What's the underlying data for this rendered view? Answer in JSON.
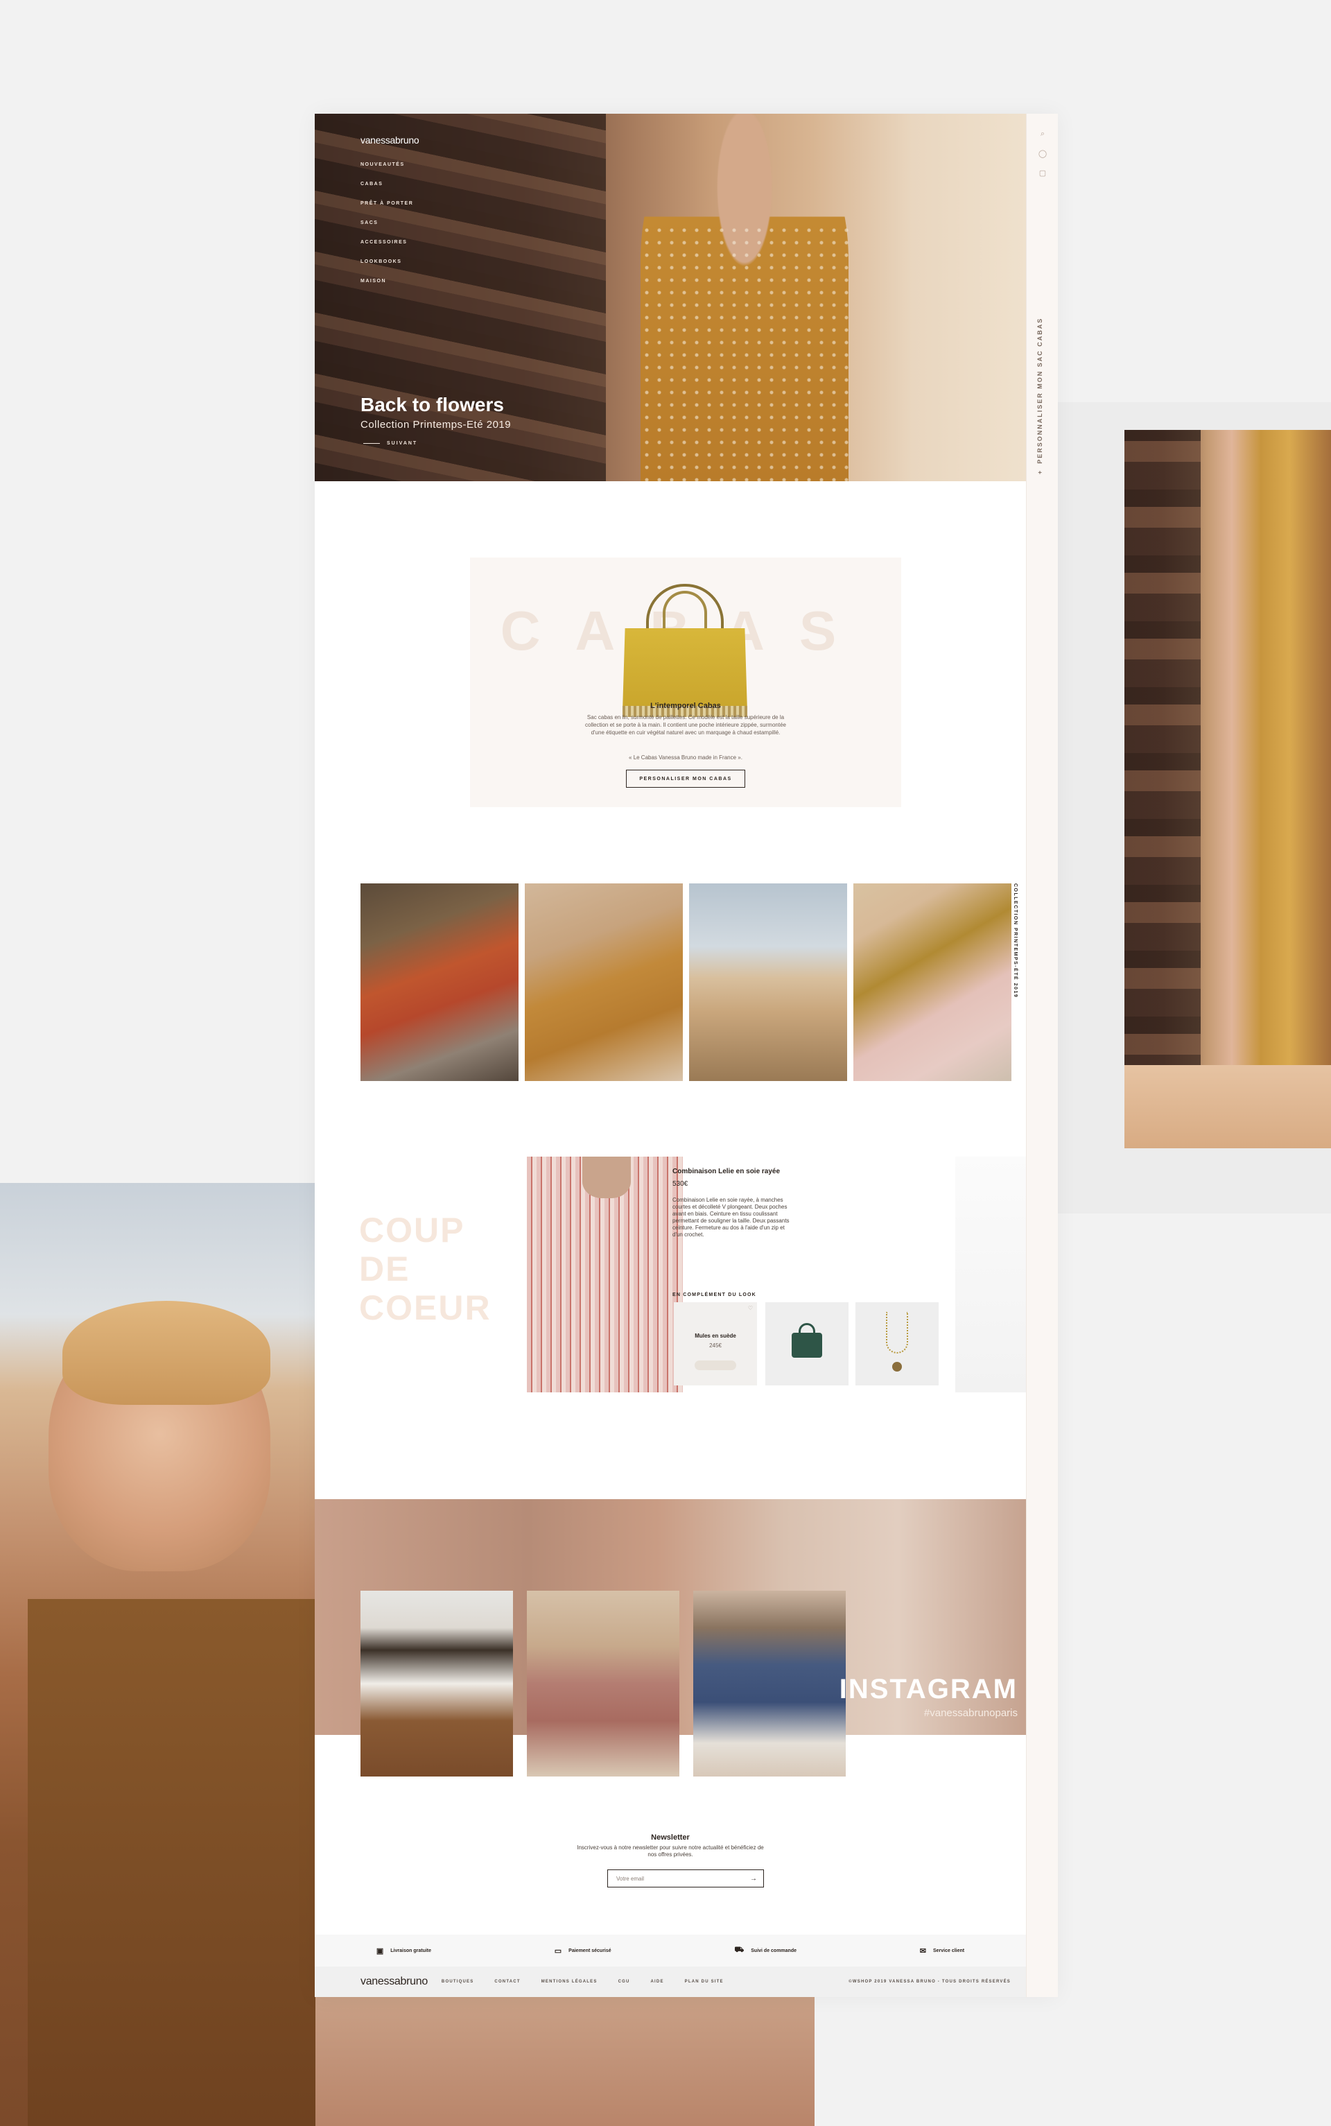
{
  "brand": "vanessabruno",
  "nav": [
    "NOUVEAUTÉS",
    "CABAS",
    "PRÊT À PORTER",
    "SACS",
    "ACCESSOIRES",
    "LOOKBOOKS",
    "MAISON"
  ],
  "rail": {
    "icons": [
      "search-icon",
      "user-icon",
      "bag-icon"
    ],
    "vertical_label": "PERSONNALISER MON SAC CABAS",
    "plus": "+"
  },
  "hero": {
    "title": "Back to flowers",
    "subtitle": "Collection Printemps-Eté 2019",
    "next": "SUIVANT"
  },
  "cabas": {
    "bg_word": "CABAS",
    "title": "L'intemporel Cabas",
    "description": "Sac cabas en lin, surmonté de paillettes. Ce modèle est la taille supérieure de la collection et se porte à la main. Il contient une poche intérieure zippée, surmontée d'une étiquette en cuir végétal naturel avec un marquage à chaud estampillé.",
    "note": "« Le Cabas Vanessa Bruno made in France ».",
    "button": "PERSONALISER MON CABAS"
  },
  "lookbook": {
    "side_label": "COLLECTION PRINTEMPS-ÉTÉ 2019"
  },
  "coup_de_coeur": {
    "title_lines": [
      "COUP",
      "DE",
      "COEUR"
    ],
    "product_name": "Combinaison Lelie en soie rayée",
    "price": "530€",
    "description": "Combinaison Lelie en soie rayée, à manches courtes et décolleté V plongeant. Deux poches avant en biais. Ceinture en tissu coulissant permettant de souligner la taille. Deux passants ceinture. Fermeture au dos à l'aide d'un zip et d'un crochet.",
    "complement_label": "EN COMPLÉMENT DU LOOK",
    "complement_items": [
      {
        "name": "Mules en suède",
        "price": "245€"
      }
    ]
  },
  "instagram": {
    "title": "INSTAGRAM",
    "hashtag": "#vanessabrunoparis"
  },
  "newsletter": {
    "title": "Newsletter",
    "description": "Inscrivez-vous à notre newsletter pour suivre notre actualité et bénéficiez de nos offres privées.",
    "placeholder": "Votre email",
    "submit": "→"
  },
  "reassurance": [
    {
      "icon": "box-icon",
      "label": "Livraison gratuite"
    },
    {
      "icon": "card-icon",
      "label": "Paiement sécurisé"
    },
    {
      "icon": "truck-icon",
      "label": "Suivi de commande"
    },
    {
      "icon": "chat-icon",
      "label": "Service client"
    }
  ],
  "footer": {
    "links": [
      "BOUTIQUES",
      "CONTACT",
      "MENTIONS LÉGALES",
      "CGU",
      "AIDE",
      "PLAN DU SITE"
    ],
    "copyright": "©WSHOP 2019 VANESSA BRUNO - TOUS DROITS RÉSERVÉS"
  }
}
